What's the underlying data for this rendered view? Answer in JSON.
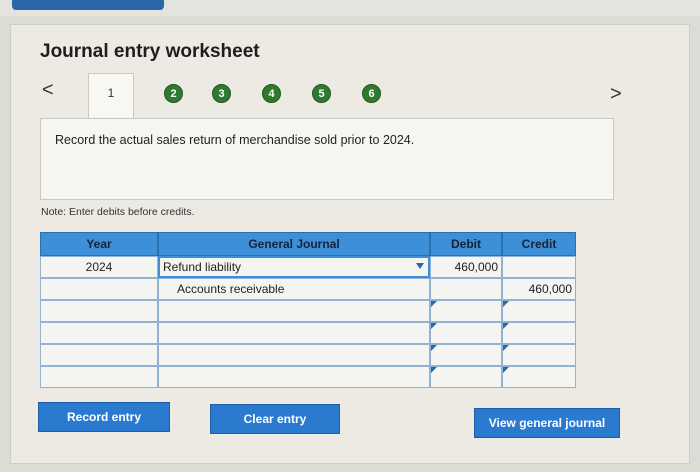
{
  "title": "Journal entry worksheet",
  "nav": {
    "prev": "<",
    "next": ">"
  },
  "steps": [
    "1",
    "2",
    "3",
    "4",
    "5",
    "6"
  ],
  "instruction": "Record the actual sales return of merchandise sold prior to 2024.",
  "note": "Note: Enter debits before credits.",
  "table": {
    "headers": {
      "year": "Year",
      "journal": "General Journal",
      "debit": "Debit",
      "credit": "Credit"
    },
    "rows": [
      {
        "year": "2024",
        "account": "Refund liability",
        "debit": "460,000",
        "credit": ""
      },
      {
        "year": "",
        "account": "Accounts receivable",
        "debit": "",
        "credit": "460,000"
      },
      {
        "year": "",
        "account": "",
        "debit": "",
        "credit": ""
      },
      {
        "year": "",
        "account": "",
        "debit": "",
        "credit": ""
      },
      {
        "year": "",
        "account": "",
        "debit": "",
        "credit": ""
      },
      {
        "year": "",
        "account": "",
        "debit": "",
        "credit": ""
      }
    ]
  },
  "buttons": {
    "record": "Record entry",
    "clear": "Clear entry",
    "view": "View general journal"
  },
  "colors": {
    "step_complete": "#2f7a2f",
    "header": "#3d8fd8",
    "button": "#2a7bd0"
  }
}
